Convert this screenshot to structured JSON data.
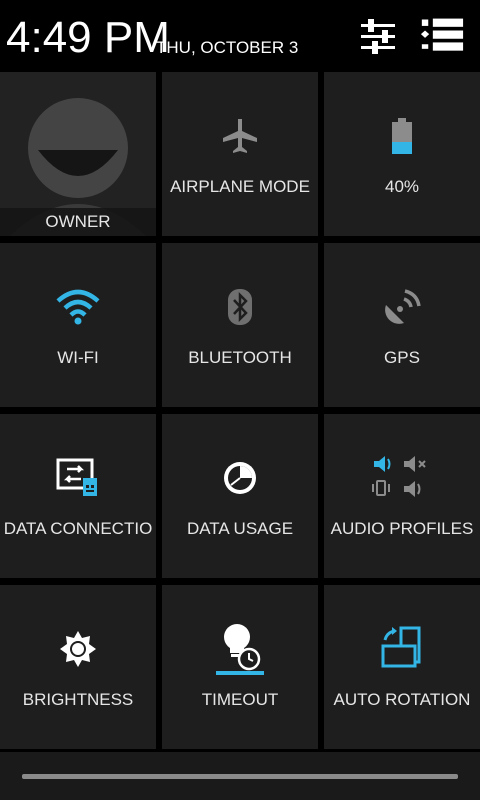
{
  "header": {
    "time": "4:49 PM",
    "date": "THU, OCTOBER 3",
    "settings_icon": "sliders-icon",
    "list_icon": "notification-list-icon"
  },
  "tiles": [
    {
      "id": "owner",
      "label": "OWNER",
      "icon": "user-avatar-icon"
    },
    {
      "id": "airplane",
      "label": "AIRPLANE MODE",
      "icon": "airplane-icon"
    },
    {
      "id": "battery",
      "label": "40%",
      "icon": "battery-icon",
      "level": 0.4
    },
    {
      "id": "wifi",
      "label": "WI-FI",
      "icon": "wifi-icon"
    },
    {
      "id": "bluetooth",
      "label": "BLUETOOTH",
      "icon": "bluetooth-icon"
    },
    {
      "id": "gps",
      "label": "GPS",
      "icon": "gps-icon"
    },
    {
      "id": "data_connection",
      "label": "DATA CONNECTIO",
      "icon": "data-connection-icon"
    },
    {
      "id": "data_usage",
      "label": "DATA USAGE",
      "icon": "data-usage-icon"
    },
    {
      "id": "audio_profiles",
      "label": "AUDIO PROFILES",
      "icon": "audio-profiles-icon"
    },
    {
      "id": "brightness",
      "label": "BRIGHTNESS",
      "icon": "brightness-icon"
    },
    {
      "id": "timeout",
      "label": "TIMEOUT",
      "icon": "timeout-icon"
    },
    {
      "id": "auto_rotation",
      "label": "AUTO ROTATION",
      "icon": "auto-rotation-icon"
    }
  ],
  "colors": {
    "accent": "#33b5e5",
    "tile_bg": "#1e1e1e",
    "dim_icon": "#8c8c8c"
  }
}
